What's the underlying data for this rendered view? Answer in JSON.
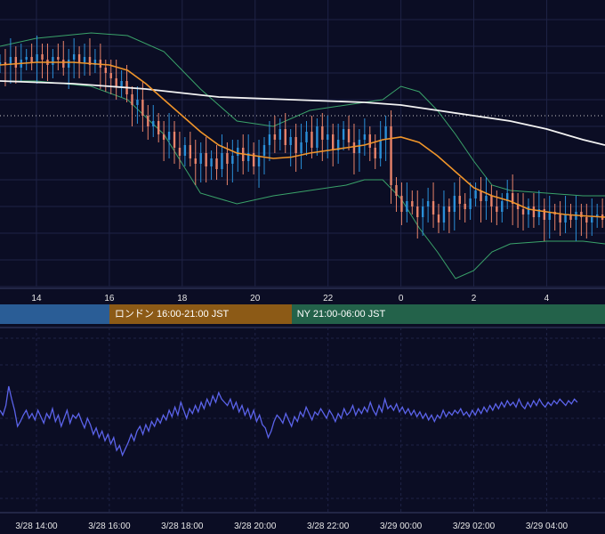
{
  "theme": {
    "background": "#0b0d24",
    "grid": "#1f2346",
    "up_color": "#2a8fd8",
    "down_color": "#e8836a",
    "ma_fast_color": "#f0952a",
    "ma_slow_color": "#f2f2f2",
    "bollinger_color": "#3aa36a",
    "reference_line_color": "#c8c8c8",
    "oscillator_color": "#5b63ea",
    "axis_text_color": "#e6e6e6"
  },
  "sessions": [
    {
      "label": "",
      "color": "#2a5d96",
      "start_hour": 13.0,
      "end_hour": 16.0
    },
    {
      "label": "ロンドン 16:00-21:00 JST",
      "color": "#8c5a16",
      "start_hour": 16.0,
      "end_hour": 21.0
    },
    {
      "label": "NY 21:00-06:00 JST",
      "color": "#23624a",
      "start_hour": 21.0,
      "end_hour": 30.0
    }
  ],
  "chart_data": [
    {
      "type": "line",
      "subtype": "candlestick",
      "x_axis": "hours (JST)",
      "xlim": [
        13.0,
        29.6
      ],
      "ylim": [
        0,
        100
      ],
      "x_ticks": [
        {
          "value": 14,
          "label": "14"
        },
        {
          "value": 16,
          "label": "16"
        },
        {
          "value": 18,
          "label": "18"
        },
        {
          "value": 20,
          "label": "20"
        },
        {
          "value": 22,
          "label": "22"
        },
        {
          "value": 24,
          "label": "0"
        },
        {
          "value": 26,
          "label": "2"
        },
        {
          "value": 28,
          "label": "4"
        }
      ],
      "grid": true,
      "reference_level": 64,
      "ma_fast": {
        "x": [
          13.0,
          14.0,
          15.0,
          16.0,
          16.5,
          17.0,
          17.5,
          18.0,
          18.5,
          19.0,
          19.5,
          20.0,
          20.5,
          21.0,
          21.5,
          22.0,
          22.5,
          23.0,
          23.5,
          24.0,
          24.5,
          25.0,
          25.5,
          26.0,
          26.5,
          27.0,
          27.5,
          28.0,
          28.5,
          29.0,
          29.6
        ],
        "values": [
          83,
          84,
          84,
          83,
          81,
          76,
          70,
          64,
          58,
          53,
          50,
          49,
          48,
          48.5,
          50,
          51,
          52,
          53,
          55,
          56,
          54,
          49,
          43,
          37,
          34,
          32,
          29,
          28,
          27,
          26.5,
          26
        ]
      },
      "ma_slow": {
        "x": [
          13.0,
          15.0,
          17.0,
          19.0,
          21.0,
          23.0,
          24.0,
          25.0,
          26.0,
          27.0,
          28.0,
          29.0,
          29.6
        ],
        "values": [
          77,
          76,
          74,
          71,
          70,
          69,
          68,
          66,
          64,
          62,
          59,
          55,
          53
        ]
      },
      "bollinger_upper": {
        "x": [
          13.0,
          14.0,
          15.5,
          16.5,
          17.5,
          18.5,
          19.5,
          20.5,
          21.5,
          22.5,
          23.5,
          24.0,
          24.5,
          25.0,
          25.5,
          26.0,
          26.5,
          27.0,
          28.0,
          29.0,
          29.6
        ],
        "values": [
          90,
          93,
          95,
          94,
          88,
          74,
          62,
          60,
          66,
          68,
          70,
          75,
          73,
          66,
          57,
          47,
          38,
          36,
          35,
          34,
          34
        ]
      },
      "bollinger_lower": {
        "x": [
          13.0,
          14.0,
          15.5,
          16.5,
          17.5,
          18.5,
          19.5,
          20.5,
          21.5,
          22.5,
          23.0,
          23.5,
          24.0,
          24.5,
          25.0,
          25.5,
          26.0,
          26.5,
          27.0,
          28.0,
          29.0,
          29.6
        ],
        "values": [
          77,
          77,
          75,
          70,
          57,
          35,
          31,
          34,
          36,
          38,
          40,
          40,
          33,
          22,
          13,
          3,
          6,
          13,
          16,
          17,
          17,
          16
        ]
      },
      "candles": {
        "x_start": 13.0,
        "x_step": 0.145,
        "close": [
          84,
          83,
          86,
          82,
          85,
          86,
          84,
          87,
          85,
          83,
          86,
          85,
          82,
          85,
          87,
          84,
          86,
          83,
          85,
          82,
          80,
          78,
          75,
          77,
          72,
          68,
          70,
          64,
          60,
          62,
          57,
          55,
          58,
          52,
          49,
          53,
          48,
          46,
          50,
          45,
          48,
          44,
          50,
          46,
          49,
          52,
          47,
          50,
          45,
          49,
          53,
          57,
          55,
          59,
          53,
          56,
          50,
          54,
          58,
          52,
          60,
          55,
          57,
          51,
          55,
          59,
          54,
          50,
          55,
          57,
          52,
          48,
          55,
          60,
          38,
          34,
          28,
          32,
          30,
          26,
          30,
          32,
          27,
          24,
          30,
          28,
          34,
          31,
          29,
          33,
          36,
          32,
          34,
          30,
          28,
          32,
          35,
          31,
          29,
          27,
          30,
          26,
          29,
          25,
          28,
          27,
          24,
          27,
          25,
          28,
          26,
          24,
          26,
          27,
          25,
          26
        ],
        "open": [
          83,
          84,
          83,
          86,
          82,
          85,
          86,
          84,
          87,
          85,
          83,
          86,
          85,
          82,
          85,
          87,
          84,
          86,
          83,
          85,
          82,
          80,
          78,
          75,
          77,
          72,
          68,
          70,
          64,
          60,
          62,
          57,
          55,
          58,
          52,
          49,
          53,
          48,
          46,
          50,
          45,
          48,
          44,
          50,
          46,
          49,
          52,
          47,
          50,
          45,
          49,
          53,
          57,
          55,
          59,
          53,
          56,
          50,
          54,
          58,
          52,
          60,
          55,
          57,
          51,
          55,
          59,
          54,
          50,
          55,
          57,
          52,
          48,
          55,
          60,
          38,
          34,
          28,
          32,
          30,
          26,
          30,
          32,
          27,
          24,
          30,
          28,
          34,
          31,
          29,
          33,
          36,
          32,
          34,
          30,
          28,
          32,
          35,
          31,
          29,
          27,
          30,
          26,
          29,
          25,
          28,
          27,
          24,
          27,
          25,
          28,
          26,
          24,
          26,
          27,
          25
        ]
      }
    },
    {
      "type": "line",
      "x_axis": "time (JST)",
      "xlim": [
        13.0,
        29.6
      ],
      "ylim": [
        0,
        100
      ],
      "x_ticks": [
        {
          "value": 14,
          "label": "3/28 14:00"
        },
        {
          "value": 16,
          "label": "3/28 16:00"
        },
        {
          "value": 18,
          "label": "3/28 18:00"
        },
        {
          "value": 20,
          "label": "3/28 20:00"
        },
        {
          "value": 22,
          "label": "3/28 22:00"
        },
        {
          "value": 24,
          "label": "3/29 00:00"
        },
        {
          "value": 26,
          "label": "3/29 02:00"
        },
        {
          "value": 28,
          "label": "3/29 04:00"
        }
      ],
      "grid": true,
      "series": [
        {
          "x_start": 13.0,
          "x_step": 0.08,
          "values": [
            55,
            52,
            58,
            70,
            62,
            55,
            45,
            48,
            52,
            55,
            50,
            53,
            49,
            55,
            51,
            47,
            53,
            50,
            56,
            48,
            52,
            45,
            50,
            55,
            47,
            52,
            50,
            53,
            48,
            44,
            50,
            46,
            40,
            44,
            38,
            42,
            36,
            40,
            34,
            38,
            30,
            33,
            27,
            31,
            35,
            40,
            36,
            42,
            45,
            40,
            46,
            42,
            48,
            45,
            50,
            47,
            52,
            49,
            55,
            51,
            57,
            52,
            60,
            55,
            50,
            56,
            53,
            58,
            54,
            60,
            56,
            62,
            58,
            64,
            60,
            66,
            62,
            60,
            58,
            62,
            56,
            60,
            54,
            58,
            52,
            56,
            50,
            55,
            48,
            52,
            46,
            44,
            38,
            42,
            48,
            52,
            50,
            47,
            53,
            49,
            45,
            51,
            48,
            54,
            51,
            57,
            53,
            49,
            54,
            52,
            56,
            53,
            50,
            55,
            52,
            48,
            53,
            50,
            56,
            52,
            54,
            58,
            52,
            56,
            53,
            57,
            54,
            60,
            55,
            52,
            58,
            54,
            62,
            56,
            58,
            55,
            59,
            54,
            57,
            53,
            56,
            52,
            55,
            51,
            54,
            50,
            53,
            49,
            52,
            48,
            52,
            50,
            55,
            51,
            54,
            52,
            55,
            53,
            56,
            52,
            54,
            51,
            55,
            52,
            56,
            53,
            57,
            54,
            58,
            55,
            59,
            56,
            60,
            57,
            61,
            58,
            60,
            57,
            62,
            58,
            56,
            60,
            57,
            61,
            58,
            62,
            59,
            57,
            60,
            58,
            61,
            59,
            62,
            60,
            58,
            61,
            59,
            62,
            60
          ]
        }
      ]
    }
  ]
}
